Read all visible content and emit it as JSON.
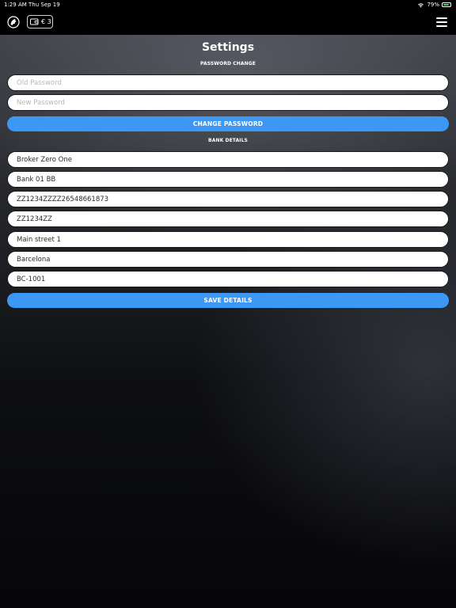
{
  "status_bar": {
    "time": "1:29 AM",
    "date": "Thu Sep 19",
    "battery": "79%",
    "battery_color": "#36d160"
  },
  "navbar": {
    "logo_icon": "lion-logo-icon",
    "wallet_icon": "wallet-icon",
    "wallet_balance": "€ 3",
    "menu_icon": "hamburger-menu-icon"
  },
  "page": {
    "title": "Settings"
  },
  "password_section": {
    "label": "PASSWORD CHANGE",
    "old_password_placeholder": "Old Password",
    "new_password_placeholder": "New Password",
    "button_label": "CHANGE PASSWORD"
  },
  "bank_section": {
    "label": "BANK DETAILS",
    "fields": [
      {
        "value": "Broker Zero One"
      },
      {
        "value": "Bank 01 BB"
      },
      {
        "value": "ZZ1234ZZZZ26548661873"
      },
      {
        "value": "ZZ1234ZZ"
      },
      {
        "value": "Main street 1"
      },
      {
        "value": "Barcelona"
      },
      {
        "value": "BC-1001"
      }
    ],
    "button_label": "SAVE DETAILS"
  },
  "colors": {
    "accent": "#3d98f3",
    "field_bg": "#ffffff",
    "header_bg": "#000000"
  }
}
